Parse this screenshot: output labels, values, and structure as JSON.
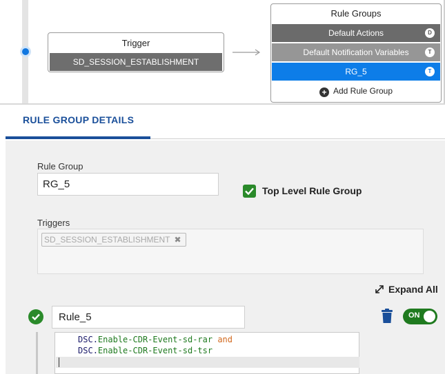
{
  "flow": {
    "trigger_title": "Trigger",
    "trigger_value": "SD_SESSION_ESTABLISHMENT",
    "rule_groups_title": "Rule Groups",
    "rule_groups": [
      {
        "label": "Default Actions",
        "badge": "D"
      },
      {
        "label": "Default Notification Variables",
        "badge": "T"
      },
      {
        "label": "RG_5",
        "badge": "T"
      }
    ],
    "add_rule_group_label": "Add Rule Group"
  },
  "details": {
    "tab_label": "RULE GROUP DETAILS",
    "rule_group_label": "Rule Group",
    "rule_group_value": "RG_5",
    "top_level_label": "Top Level Rule Group",
    "top_level_checked": true,
    "triggers_label": "Triggers",
    "trigger_chips": [
      "SD_SESSION_ESTABLISHMENT"
    ],
    "expand_all_label": "Expand All"
  },
  "rule": {
    "name": "Rule_5",
    "enabled_label": "ON",
    "code_lines": [
      {
        "obj": "DSC",
        "prop": "Enable-CDR-Event-sd-rar",
        "kw": "and"
      },
      {
        "obj": "DSC",
        "prop": "Enable-CDR-Event-sd-tsr",
        "kw": ""
      }
    ]
  },
  "colors": {
    "accent_blue": "#1a4f9a",
    "selected_blue": "#0d7de8",
    "success_green": "#2a8a2a",
    "toggle_green": "#1f7a1f"
  }
}
